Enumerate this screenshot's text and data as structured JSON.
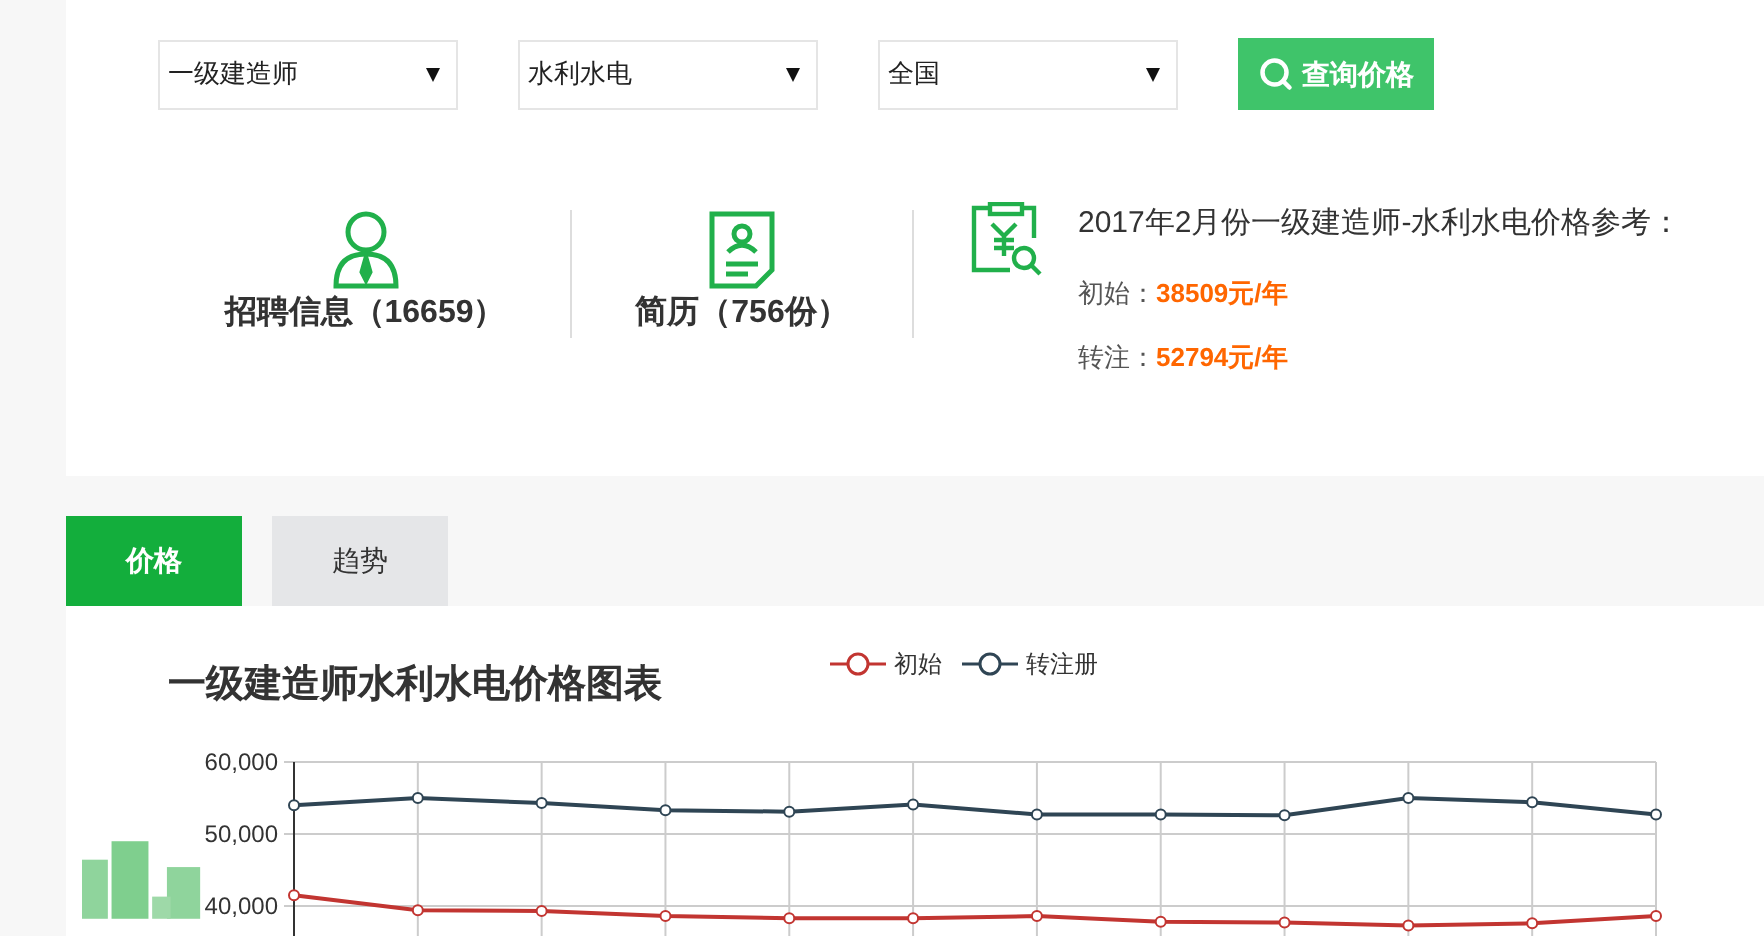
{
  "filters": [
    {
      "value": "一级建造师"
    },
    {
      "value": "水利水电"
    },
    {
      "value": "全国"
    }
  ],
  "search_button": {
    "label": "查询价格"
  },
  "stats": [
    {
      "kind": "person",
      "label": "招聘信息（16659）"
    },
    {
      "kind": "resume",
      "label": "简历（756份）"
    }
  ],
  "price_reference": {
    "title": "2017年2月份一级建造师-水利水电价格参考：",
    "rows": [
      {
        "label": "初始：",
        "value": "38509元/年"
      },
      {
        "label": "转注：",
        "value": "52794元/年"
      }
    ]
  },
  "tabs": [
    {
      "label": "价格",
      "selected": true
    },
    {
      "label": "趋势",
      "selected": false
    }
  ],
  "chart": {
    "title": "一级建造师水利水电价格图表",
    "chart_data": {
      "type": "line",
      "grid": true,
      "ylim": [
        30000,
        60000
      ],
      "yticks": [
        {
          "value": 40000,
          "label": "40,000"
        },
        {
          "value": 50000,
          "label": "50,000"
        },
        {
          "value": 60000,
          "label": "60,000"
        }
      ],
      "series": [
        {
          "name": "初始",
          "color": "#c23531",
          "marker": true,
          "values": [
            41500,
            39400,
            39300,
            38600,
            38300,
            38300,
            38600,
            37800,
            37700,
            37300,
            37600,
            38600
          ]
        },
        {
          "name": "转注册",
          "color": "#2f4554",
          "marker": true,
          "values": [
            54000,
            55000,
            54300,
            53300,
            53100,
            54100,
            52700,
            52700,
            52600,
            55000,
            54400,
            52700
          ]
        }
      ]
    }
  }
}
